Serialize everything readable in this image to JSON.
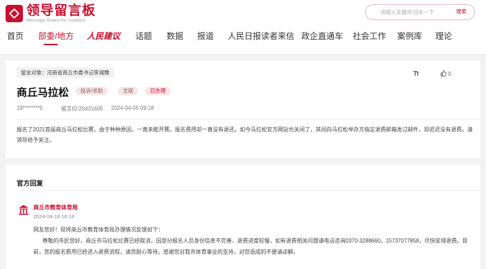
{
  "logo": {
    "title": "领导留言板",
    "subtitle": "Message Board for Leaders"
  },
  "search": {
    "placeholder": "请输入关键词 回车一下",
    "button": "搜索"
  },
  "nav": [
    "首页",
    "部委/地方",
    "人民建议",
    "话题",
    "数据",
    "报道",
    "人民日报读者来信",
    "政企直通车",
    "社会工作",
    "案例库",
    "理论"
  ],
  "message": {
    "target": "留言对象：河南省商丘市委书记李湘豫",
    "title": "商丘马拉松",
    "category": "投诉/求助",
    "field": "文娱",
    "status": "已办理",
    "user": "19********5",
    "id": "留言ID:20431605",
    "time": "2024-04-05 09:18",
    "likes": "0",
    "font_tool": "Tт",
    "body": "报名了2021首届商丘马拉松比赛，由于种种原因，一直未能开赛。报名费用却一直没有退还。如今马拉松官方网站也关闭了，其间向马拉松举办方指定退费邮箱发过邮件，却迟迟没有退费。请领导给予关注。"
  },
  "reply": {
    "heading": "官方回复",
    "org": "商丘市教育体育局",
    "date": "2024-04-18 16:18",
    "greeting": "网友您好！现将商丘市教育体育局办理情况反馈如下：",
    "content": "尊敬的市民您好，商丘市马拉松比赛已经取消，因部分报名人员身份信息不完善，退费进度较慢，如有退费相关问题请电话咨询0370-3288660，15737077858，尽快安排退费。目前，您的报名费用已经进入退费流程，请您耐心等待。感谢您对我市体育事业的支持，对您造成的不便请谅解。"
  },
  "colors": {
    "brand": "#c8102e",
    "background": "#f3f3f3"
  }
}
